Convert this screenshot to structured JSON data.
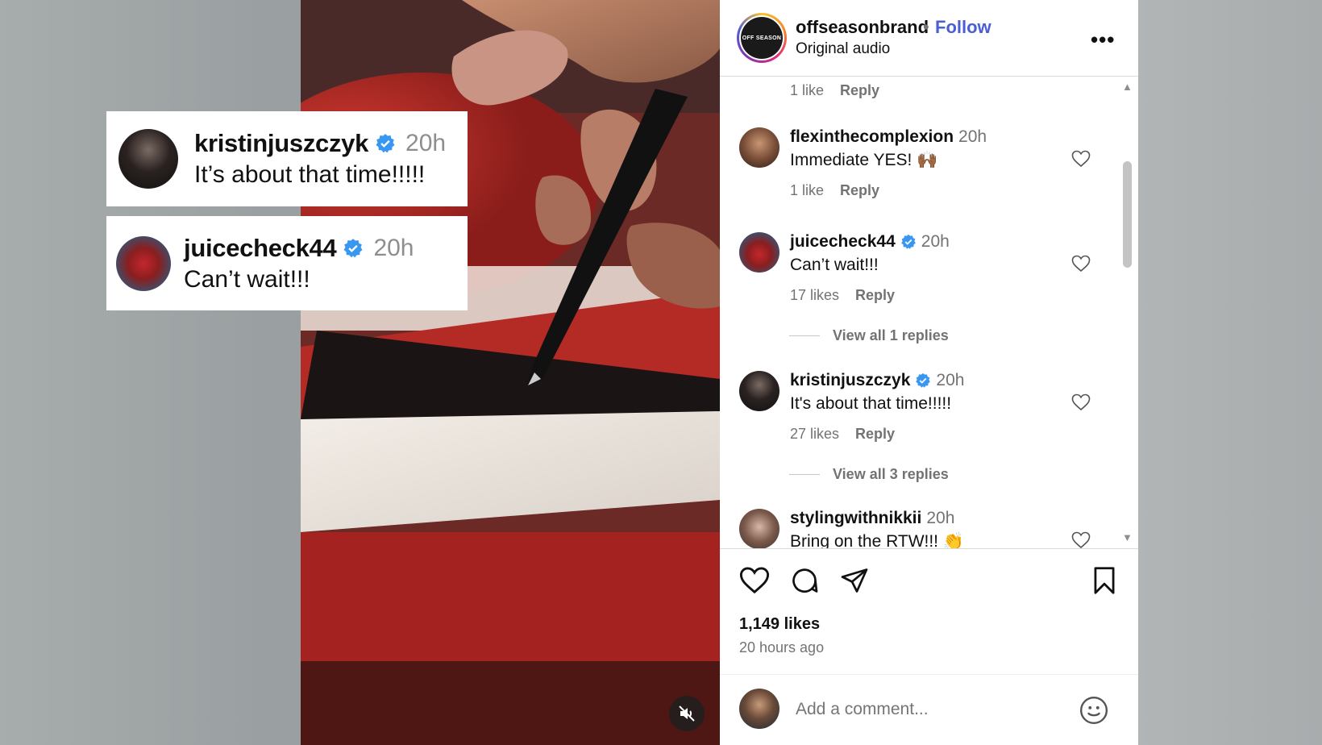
{
  "overlay_cards": [
    {
      "username": "kristinjuszczyk",
      "time": "20h",
      "message": "It’s about that time!!!!!"
    },
    {
      "username": "juicecheck44",
      "time": "20h",
      "message": "Can’t wait!!!"
    }
  ],
  "post": {
    "username": "offseasonbrand",
    "separator": "•",
    "follow_label": "Follow",
    "audio": "Original audio",
    "avatar_text": "OFF SEASON",
    "more_icon": "more-horizontal-icon"
  },
  "comments_top": {
    "likes": "1 like",
    "reply": "Reply"
  },
  "comments": [
    {
      "username": "flexinthecomplexion",
      "time": "20h",
      "text": "Immediate YES! 🙌🏾",
      "likes": "1 like",
      "reply": "Reply",
      "verified": false
    },
    {
      "username": "juicecheck44",
      "time": "20h",
      "text": "Can’t wait!!!",
      "likes": "17 likes",
      "reply": "Reply",
      "verified": true,
      "view_replies": "View all 1 replies"
    },
    {
      "username": "kristinjuszczyk",
      "time": "20h",
      "text": "It's about that time!!!!!",
      "likes": "27 likes",
      "reply": "Reply",
      "verified": true,
      "view_replies": "View all 3 replies"
    },
    {
      "username": "stylingwithnikkii",
      "time": "20h",
      "text": "Bring on the RTW!!! 👏",
      "verified": false
    }
  ],
  "actions": {
    "likes_count": "1,149 likes",
    "time_ago": "20 hours ago",
    "icons": [
      "heart-icon",
      "comment-icon",
      "share-icon",
      "bookmark-icon"
    ]
  },
  "add_comment": {
    "placeholder": "Add a comment...",
    "emoji_icon": "smiley-icon"
  },
  "colors": {
    "verified": "#3897f0",
    "follow": "#4a5fd0",
    "muted_text": "#737373"
  }
}
